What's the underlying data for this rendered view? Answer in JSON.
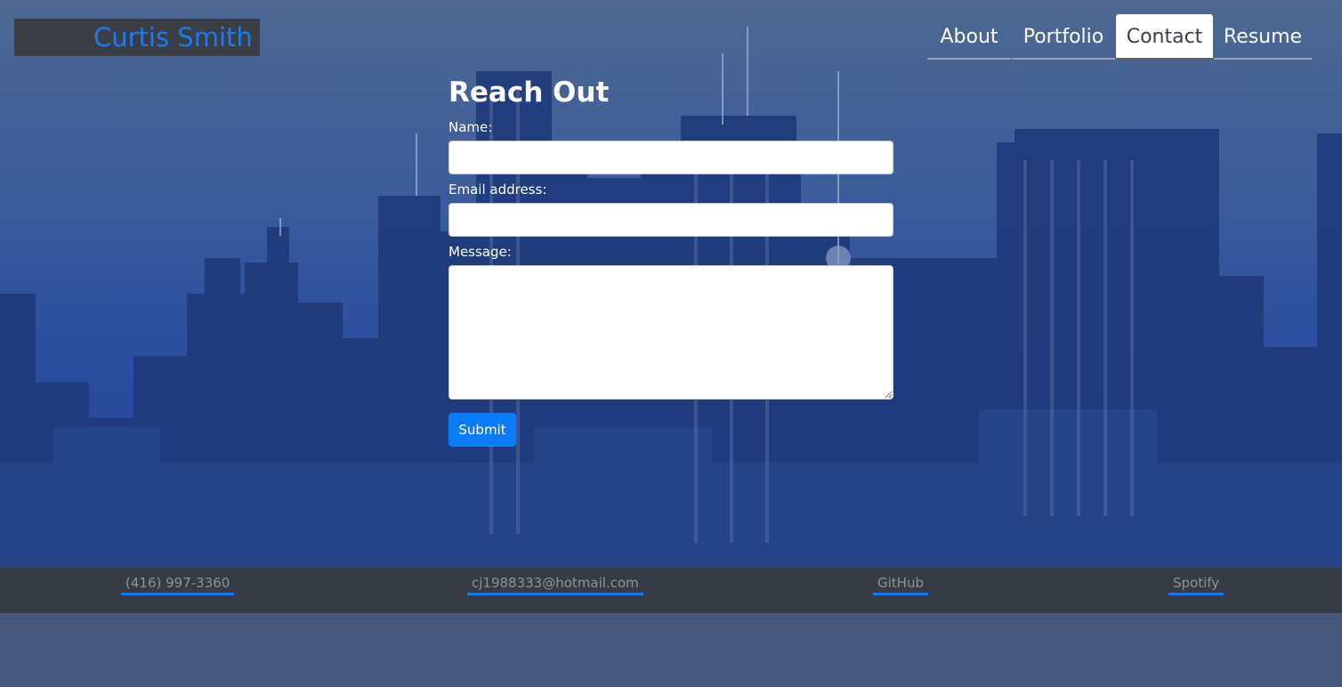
{
  "brand": {
    "name": "Curtis Smith"
  },
  "nav": {
    "items": [
      {
        "label": "About"
      },
      {
        "label": "Portfolio"
      },
      {
        "label": "Contact",
        "active": true
      },
      {
        "label": "Resume"
      }
    ]
  },
  "contact": {
    "title": "Reach Out",
    "name_label": "Name:",
    "email_label": "Email address:",
    "message_label": "Message:",
    "name_value": "",
    "email_value": "",
    "message_value": "",
    "submit_label": "Submit"
  },
  "footer": {
    "phone": "(416) 997-3360",
    "email": "cj1988333@hotmail.com",
    "github": "GitHub",
    "spotify": "Spotify"
  },
  "colors": {
    "accent": "#0b7cf7",
    "brand_text": "#1a7cf0",
    "footer_bg": "#363b44",
    "page_bg": "#45577a"
  }
}
